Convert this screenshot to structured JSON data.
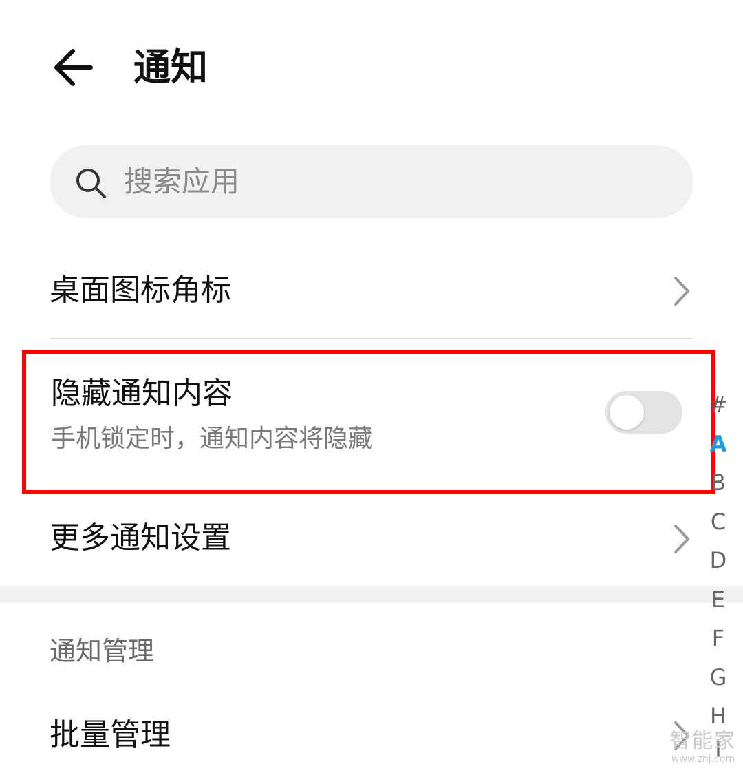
{
  "header": {
    "title": "通知",
    "back_icon": "arrow-left-icon"
  },
  "search": {
    "placeholder": "搜索应用",
    "icon": "search-icon"
  },
  "rows": {
    "badge": {
      "label": "桌面图标角标"
    },
    "hide_content": {
      "label": "隐藏通知内容",
      "subtitle": "手机锁定时，通知内容将隐藏",
      "toggle_on": false
    },
    "more_settings": {
      "label": "更多通知设置"
    }
  },
  "section": {
    "header": "通知管理",
    "batch_manage": {
      "label": "批量管理"
    }
  },
  "alphabet_index": {
    "letters": [
      "#",
      "A",
      "B",
      "C",
      "D",
      "E",
      "F",
      "G",
      "H",
      "I"
    ],
    "active": "A"
  },
  "watermark": {
    "text": "智能家",
    "url": "www.znj.com"
  },
  "colors": {
    "highlight": "#ff0000",
    "accent": "#1a9ee0",
    "search_bg": "#f1f1f1"
  }
}
